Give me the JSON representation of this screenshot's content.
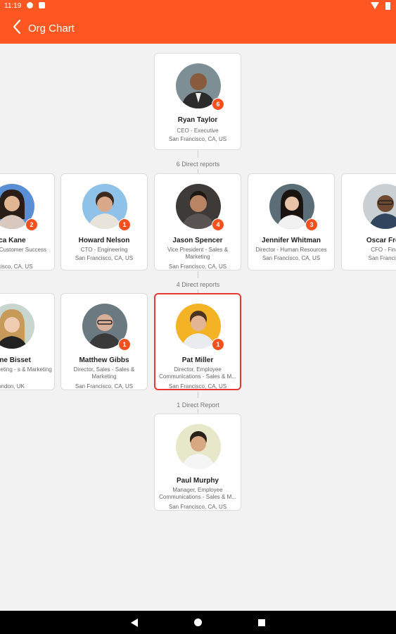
{
  "status": {
    "time": "11:19"
  },
  "appbar": {
    "title": "Org Chart",
    "back_icon": "arrow-left-icon"
  },
  "colors": {
    "accent": "#ff5722",
    "badge": "#f4511e",
    "selected_border": "#e53935"
  },
  "ceo": {
    "name": "Ryan Taylor",
    "role": "CEO - Executive",
    "location": "San Francisco, CA, US",
    "reports": "6"
  },
  "level1_label": "6 Direct reports",
  "level1": [
    {
      "name": "ica Kane",
      "role": "esident - Customer Success",
      "location": "rancisco, CA, US",
      "reports": "2"
    },
    {
      "name": "Howard Nelson",
      "role": "CTO - Engineering",
      "location": "San Francisco, CA, US",
      "reports": "1"
    },
    {
      "name": "Jason Spencer",
      "role": "Vice President - Sales & Marketing",
      "location": "San Francisco, CA, US",
      "reports": "4"
    },
    {
      "name": "Jennifer Whitman",
      "role": "Director - Human Resources",
      "location": "San Francisco, CA, US",
      "reports": "3"
    },
    {
      "name": "Oscar Free",
      "role": "CFO - Fina",
      "location": "San Francisc",
      "reports": ""
    }
  ],
  "level2_label": "4 Direct reports",
  "level2": [
    {
      "name": "eline Bisset",
      "role": "roduct Marketing - s & Marketing",
      "location": "ondon, UK",
      "reports": ""
    },
    {
      "name": "Matthew Gibbs",
      "role": "Director, Sales - Sales & Marketing",
      "location": "San Francisco, CA, US",
      "reports": "1"
    },
    {
      "name": "Pat Miller",
      "role": "Director, Employee Communications - Sales & M...",
      "location": "San Francisco, CA, US",
      "reports": "1"
    }
  ],
  "level3_label": "1 Direct Report",
  "level3": [
    {
      "name": "Paul Murphy",
      "role": "Manager, Employee Communications - Sales & M...",
      "location": "San Francisco, CA, US",
      "reports": ""
    }
  ],
  "navbar": {
    "back": "nav-back-icon",
    "home": "nav-home-icon",
    "recents": "nav-recents-icon"
  }
}
